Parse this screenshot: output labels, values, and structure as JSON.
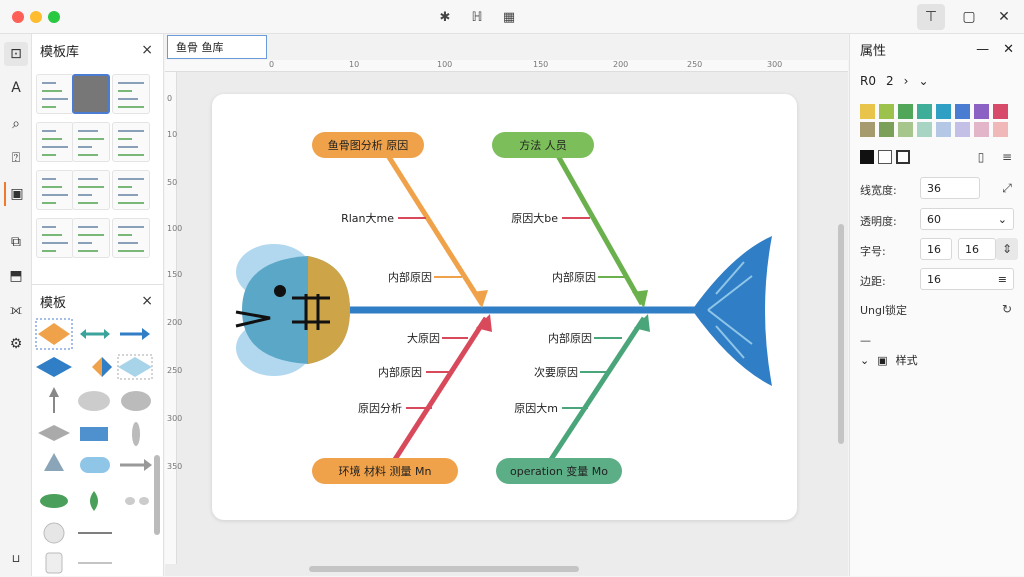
{
  "window": {
    "traffic_lights": [
      "#fe5f57",
      "#febc2e",
      "#28c840"
    ],
    "toolbar_icons": [
      "pointer-icon",
      "text-format-icon",
      "table-icon"
    ],
    "right_buttons": [
      "text-style-button",
      "frame-button",
      "close-button"
    ]
  },
  "left_toolbar": [
    "shape-library-icon",
    "text-tool-icon",
    "search-icon",
    "comment-icon",
    "template-icon",
    "plugin-icon",
    "layers-icon",
    "connector-icon",
    "integration-icon"
  ],
  "library": {
    "title": "模板库",
    "close": "×"
  },
  "templates": {
    "title": "模板",
    "close": "×"
  },
  "tab": {
    "label": "鱼骨 鱼库"
  },
  "ruler": {
    "h_ticks": [
      "0",
      "10",
      "100",
      "150",
      "200",
      "250",
      "300"
    ],
    "v_ticks": [
      "0",
      "10",
      "50",
      "100",
      "150",
      "200",
      "250",
      "300",
      "350"
    ]
  },
  "diagram": {
    "top_left_label": "鱼骨图分析 原因",
    "top_right_label": "方法 人员",
    "bottom_left_label": "环境 材料 测量 Mn",
    "bottom_right_label": "operation 变量 Mo",
    "branch_texts": {
      "tl1": "Rlan大me",
      "tl2": "内部原因",
      "tr1": "原因大be",
      "tr2": "内部原因",
      "bl1": "大原因",
      "bl2": "内部原因",
      "bl3": "原因分析",
      "br1": "内部原因",
      "br2": "次要原因",
      "br3": "原因大m"
    },
    "colors": {
      "orange": "#f0a24a",
      "green": "#6ab04c",
      "red": "#d84a5b",
      "teal": "#4aa57b",
      "blue": "#2f7ec6",
      "fish_head": "#d9a43a",
      "fish_tail": "#3a8fd6"
    }
  },
  "properties": {
    "title": "属性",
    "row_label": "R0",
    "row_value": "2",
    "colors_row1": [
      "#e8c44a",
      "#9cc24b",
      "#52a65a",
      "#3fae99",
      "#2fa0c4",
      "#4a7dd1",
      "#8b62c4",
      "#d84a6a"
    ],
    "colors_row2": [
      "#a59b6e",
      "#7aa05a",
      "#a7c68e",
      "#a8d4c4",
      "#b4c8e6",
      "#c4bfe6",
      "#e2b5c8",
      "#f0b8b8"
    ],
    "stroke_label": "线宽度:",
    "stroke_value": "36",
    "opacity_label": "透明度:",
    "opacity_value": "60",
    "size_label": "字号:",
    "size_value_a": "16",
    "size_value_b": "16",
    "spacing_label": "边距:",
    "spacing_value": "16",
    "unlink_label": "Ungl锁定",
    "dash": "—",
    "section_label": "样式"
  }
}
